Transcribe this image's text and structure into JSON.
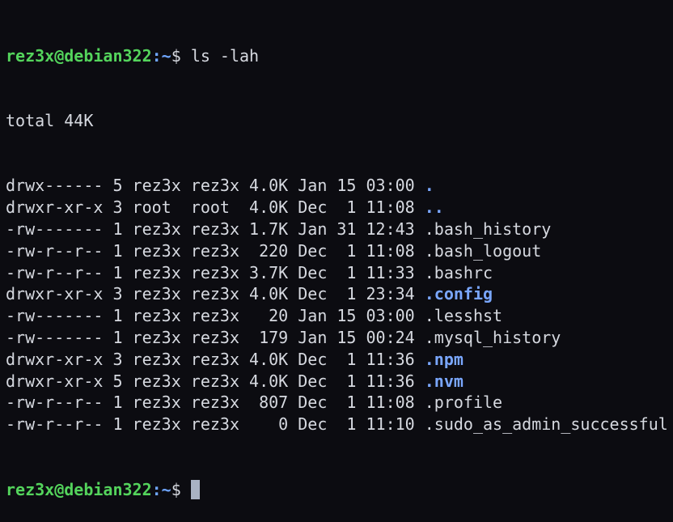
{
  "prompt": {
    "user_host": "rez3x@debian322",
    "separator": ":",
    "path": "~",
    "symbol": "$ "
  },
  "command": "ls -lah",
  "total": "total 44K",
  "entries": [
    {
      "meta": "drwx------ 5 rez3x rez3x 4.0K Jan 15 03:00 ",
      "name": ".",
      "is_dir": true
    },
    {
      "meta": "drwxr-xr-x 3 root  root  4.0K Dec  1 11:08 ",
      "name": "..",
      "is_dir": true
    },
    {
      "meta": "-rw------- 1 rez3x rez3x 1.7K Jan 31 12:43 ",
      "name": ".bash_history",
      "is_dir": false
    },
    {
      "meta": "-rw-r--r-- 1 rez3x rez3x  220 Dec  1 11:08 ",
      "name": ".bash_logout",
      "is_dir": false
    },
    {
      "meta": "-rw-r--r-- 1 rez3x rez3x 3.7K Dec  1 11:33 ",
      "name": ".bashrc",
      "is_dir": false
    },
    {
      "meta": "drwxr-xr-x 3 rez3x rez3x 4.0K Dec  1 23:34 ",
      "name": ".config",
      "is_dir": true
    },
    {
      "meta": "-rw------- 1 rez3x rez3x   20 Jan 15 03:00 ",
      "name": ".lesshst",
      "is_dir": false
    },
    {
      "meta": "-rw------- 1 rez3x rez3x  179 Jan 15 00:24 ",
      "name": ".mysql_history",
      "is_dir": false
    },
    {
      "meta": "drwxr-xr-x 3 rez3x rez3x 4.0K Dec  1 11:36 ",
      "name": ".npm",
      "is_dir": true
    },
    {
      "meta": "drwxr-xr-x 5 rez3x rez3x 4.0K Dec  1 11:36 ",
      "name": ".nvm",
      "is_dir": true
    },
    {
      "meta": "-rw-r--r-- 1 rez3x rez3x  807 Dec  1 11:08 ",
      "name": ".profile",
      "is_dir": false
    },
    {
      "meta": "-rw-r--r-- 1 rez3x rez3x    0 Dec  1 11:10 ",
      "name": ".sudo_as_admin_successful",
      "is_dir": false
    }
  ],
  "colors": {
    "background": "#0c0c11",
    "foreground": "#d6d9e0",
    "prompt_user": "#54d45c",
    "prompt_path": "#6fa6ff",
    "directory": "#7aa7ff",
    "cursor": "#a9b2c3"
  }
}
